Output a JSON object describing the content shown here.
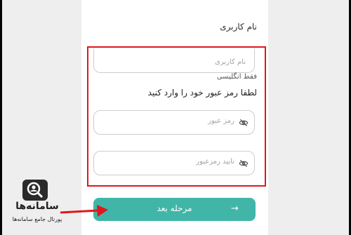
{
  "form": {
    "username_label": "نام کاربری",
    "username_placeholder": "نام کاربری",
    "english_only_hint": "فقط انگلیسی",
    "password_prompt": "لطفا رمز عبور خود را وارد کنید",
    "password_placeholder": "رمز عبور",
    "confirm_password_placeholder": "تایید رمزعبور",
    "next_button_label": "مرحله بعد",
    "next_button_arrow": "→"
  },
  "logo": {
    "name": "سامانه‌ها",
    "subtitle": "پورتال جامع سامانه‌ها"
  },
  "colors": {
    "accent": "#41b6a8",
    "highlight_border": "#e0171c",
    "annotation_arrow": "#e0171c"
  },
  "icons": {
    "password_visibility": "eye-off-icon",
    "next_arrow": "arrow-right-icon",
    "logo": "magnifier-person-icon"
  }
}
